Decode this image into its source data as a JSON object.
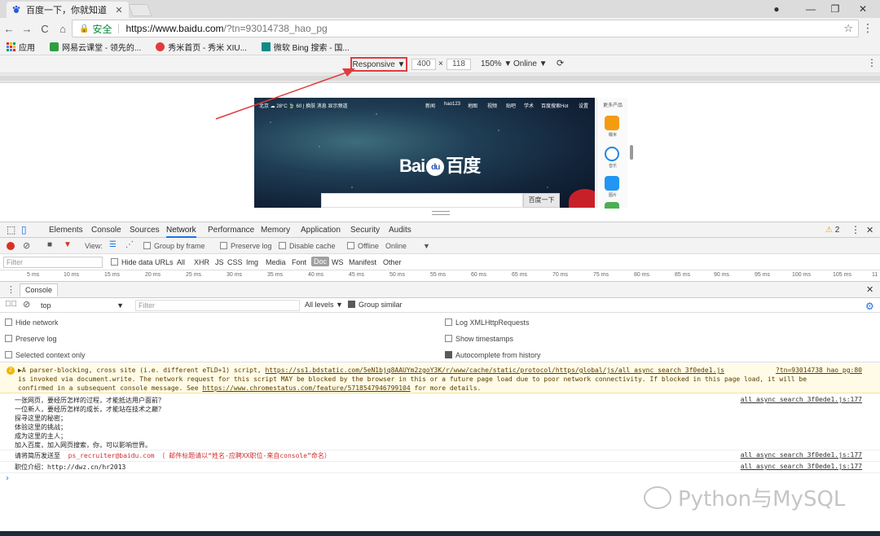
{
  "browser": {
    "tab_title": "百度一下，你就知道",
    "tab_close": "✕",
    "win_user": "●",
    "win_min": "—",
    "win_max": "❐",
    "win_close": "✕",
    "back": "←",
    "forward": "→",
    "reload": "C",
    "home": "⌂",
    "secure_label": "安全",
    "url_host": "https://www.baidu.com",
    "url_rest": "/?tn=93014738_hao_pg",
    "star": "☆",
    "menu": "⋮"
  },
  "bookmarks": [
    {
      "label": "应用",
      "color": "#d93025"
    },
    {
      "label": "网易云课堂 - 领先的...",
      "color": "#2e9e3f"
    },
    {
      "label": "秀米首页 - 秀米 XIU...",
      "color": "#e23b3b"
    },
    {
      "label": "微软 Bing 搜索 - 国...",
      "color": "#138a8a"
    }
  ],
  "device_toolbar": {
    "responsive": "Responsive ▼",
    "width": "400",
    "times": "×",
    "height": "118",
    "zoom": "150% ▼",
    "network": "Online ▼",
    "rotate": "⟳",
    "menu": "⋮"
  },
  "baidu_page": {
    "weather": "北京  ☁  28°C  🍃 60  |  换肤  消息  显示频道",
    "nav": [
      "新闻",
      "hao123",
      "地图",
      "视频",
      "贴吧",
      "学术",
      "百度搜索Hot",
      "设置"
    ],
    "logo_left": "Bai",
    "logo_paw": "du",
    "logo_right": "百度",
    "search_btn": "百度一下",
    "sidebar_title": "更多产品",
    "sidebar_items": [
      "糯米",
      "音乐",
      "图片",
      "..."
    ]
  },
  "devtools": {
    "tabs": [
      "Elements",
      "Console",
      "Sources",
      "Network",
      "Performance",
      "Memory",
      "Application",
      "Security",
      "Audits"
    ],
    "active_tab": "Network",
    "warning_count": "2",
    "more": "⋮",
    "close": "✕",
    "net": {
      "view": "View:",
      "group_by_frame": "Group by frame",
      "preserve_log": "Preserve log",
      "disable_cache": "Disable cache",
      "offline": "Offline",
      "online": "Online"
    },
    "filter": {
      "placeholder": "Filter",
      "hide_data_urls": "Hide data URLs",
      "types": [
        "All",
        "XHR",
        "JS",
        "CSS",
        "Img",
        "Media",
        "Font",
        "Doc",
        "WS",
        "Manifest",
        "Other"
      ],
      "active_type": "Doc"
    },
    "timeline": [
      "5 ms",
      "10 ms",
      "15 ms",
      "20 ms",
      "25 ms",
      "30 ms",
      "35 ms",
      "40 ms",
      "45 ms",
      "50 ms",
      "55 ms",
      "60 ms",
      "65 ms",
      "70 ms",
      "75 ms",
      "80 ms",
      "85 ms",
      "90 ms",
      "95 ms",
      "100 ms",
      "105 ms",
      "11"
    ]
  },
  "console": {
    "drawer_label": "Console",
    "context": "top",
    "filter_placeholder": "Filter",
    "levels": "All levels ▼",
    "group_similar": "Group similar",
    "settings_left": [
      "Hide network",
      "Preserve log",
      "Selected context only"
    ],
    "settings_right": [
      "Log XMLHttpRequests",
      "Show timestamps",
      "Autocomplete from history"
    ],
    "warning": {
      "line1_prefix": "▶A parser-blocking, cross site (i.e. different eTLD+1) script, ",
      "line1_link": "https://ss1.bdstatic.com/5eN1bjq8AAUYm2zgoY3K/r/www/cache/static/protocol/https/global/js/all_async_search_3f0ede1.js",
      "line1_src": "?tn=93014738_hao_pg:80",
      "line2": "is invoked via document.write. The network request for this script MAY be blocked by the browser in this or a future page load due to poor network connectivity. If blocked in this page load, it will be",
      "line3_prefix": "confirmed in a subsequent console message. See ",
      "line3_link": "https://www.chromestatus.com/feature/5718547946799104",
      "line3_suffix": " for more details."
    },
    "log1": "一张网页，要经历怎样的过程，才能抵达用户面前？\n一位新人，要经历怎样的成长，才能站在技术之巅？\n探寻这里的秘密；\n体验这里的挑战；\n成为这里的主人；\n加入百度，加入网页搜索，你，可以影响世界。",
    "log2_prefix": "请将简历发送至  ",
    "log2_red": "ps_recruiter@baidu.com （ 邮件标题请以“姓名-应聘XX职位-来自console”命名）",
    "log3": "职位介绍：http://dwz.cn/hr2013",
    "src": "all_async_search_3f0ede1.js:177",
    "prompt": "›"
  },
  "watermark": "Python与MySQL"
}
